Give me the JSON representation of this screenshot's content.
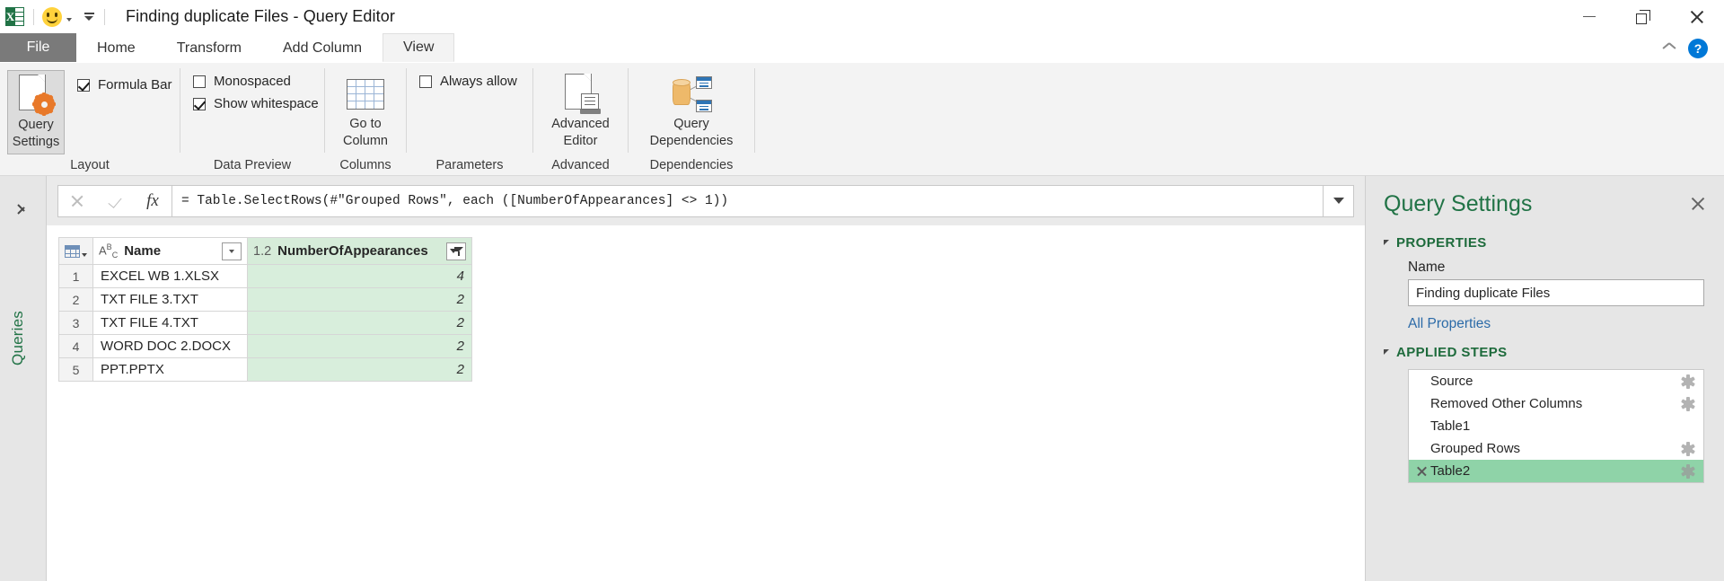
{
  "window": {
    "title": "Finding duplicate Files - Query Editor",
    "app_icon": "excel-icon",
    "quick_access": [
      "smiley-icon",
      "customize-qat-caret"
    ],
    "minimize_label": "—",
    "restore_label": "❐",
    "close_label": "✕"
  },
  "tabs": {
    "file_label": "File",
    "items": [
      {
        "label": "Home",
        "active": false
      },
      {
        "label": "Transform",
        "active": false
      },
      {
        "label": "Add Column",
        "active": false
      },
      {
        "label": "View",
        "active": true
      }
    ],
    "collapse_ribbon_icon": "chevron-up-icon",
    "help_label": "?"
  },
  "ribbon": {
    "groups": [
      {
        "label": "Layout",
        "big_buttons": [
          {
            "label_line1": "Query",
            "label_line2": "Settings",
            "icon": "query-settings-icon",
            "pressed": true
          }
        ],
        "checkboxes": [
          {
            "label": "Formula Bar",
            "checked": true
          }
        ]
      },
      {
        "label": "Data Preview",
        "checkboxes": [
          {
            "label": "Monospaced",
            "checked": false
          },
          {
            "label": "Show whitespace",
            "checked": true
          }
        ]
      },
      {
        "label": "Columns",
        "big_buttons": [
          {
            "label_line1": "Go to",
            "label_line2": "Column",
            "icon": "grid-icon",
            "pressed": false
          }
        ]
      },
      {
        "label": "Parameters",
        "checkboxes": [
          {
            "label": "Always allow",
            "checked": false
          }
        ]
      },
      {
        "label": "Advanced",
        "big_buttons": [
          {
            "label_line1": "Advanced",
            "label_line2": "Editor",
            "icon": "advanced-editor-icon",
            "pressed": false
          }
        ]
      },
      {
        "label": "Dependencies",
        "big_buttons": [
          {
            "label_line1": "Query",
            "label_line2": "Dependencies",
            "icon": "query-dependencies-icon",
            "pressed": false
          }
        ]
      }
    ]
  },
  "queries_rail": {
    "expand_icon": "chevron-right-icon",
    "label": "Queries"
  },
  "formula_bar": {
    "cancel_icon": "cancel-x-icon",
    "accept_icon": "accept-check-icon",
    "fx_label": "fx",
    "formula": "= Table.SelectRows(#\"Grouped Rows\", each ([NumberOfAppearances] <> 1))",
    "expand_icon": "chevron-down-icon"
  },
  "grid": {
    "columns": [
      {
        "name": "Name",
        "type_glyph": "ABC",
        "has_filter_applied": false
      },
      {
        "name": "NumberOfAppearances",
        "type_glyph": "1.2",
        "has_filter_applied": true
      }
    ],
    "rows": [
      {
        "num": "1",
        "name": "EXCEL WB 1.XLSX",
        "appearances": "4"
      },
      {
        "num": "2",
        "name": "TXT FILE 3.TXT",
        "appearances": "2"
      },
      {
        "num": "3",
        "name": "TXT FILE 4.TXT",
        "appearances": "2"
      },
      {
        "num": "4",
        "name": "WORD DOC 2.DOCX",
        "appearances": "2"
      },
      {
        "num": "5",
        "name": "PPT.PPTX",
        "appearances": "2"
      }
    ]
  },
  "query_settings": {
    "title": "Query Settings",
    "close_icon": "close-icon",
    "properties_label": "PROPERTIES",
    "name_label": "Name",
    "name_value": "Finding duplicate Files",
    "all_properties_label": "All Properties",
    "applied_steps_label": "APPLIED STEPS",
    "steps": [
      {
        "label": "Source",
        "has_gear": true,
        "selected": false,
        "deletable": false
      },
      {
        "label": "Removed Other Columns",
        "has_gear": true,
        "selected": false,
        "deletable": false
      },
      {
        "label": "Table1",
        "has_gear": false,
        "selected": false,
        "deletable": false
      },
      {
        "label": "Grouped Rows",
        "has_gear": true,
        "selected": false,
        "deletable": false
      },
      {
        "label": "Table2",
        "has_gear": true,
        "selected": true,
        "deletable": true
      }
    ]
  },
  "colors": {
    "accent_green": "#217346",
    "selection_green": "#8fd3a8",
    "column_highlight": "#d8eedc",
    "ribbon_bg": "#f3f3f3",
    "pane_bg": "#e6e6e6",
    "link_blue": "#2c6ba8"
  }
}
